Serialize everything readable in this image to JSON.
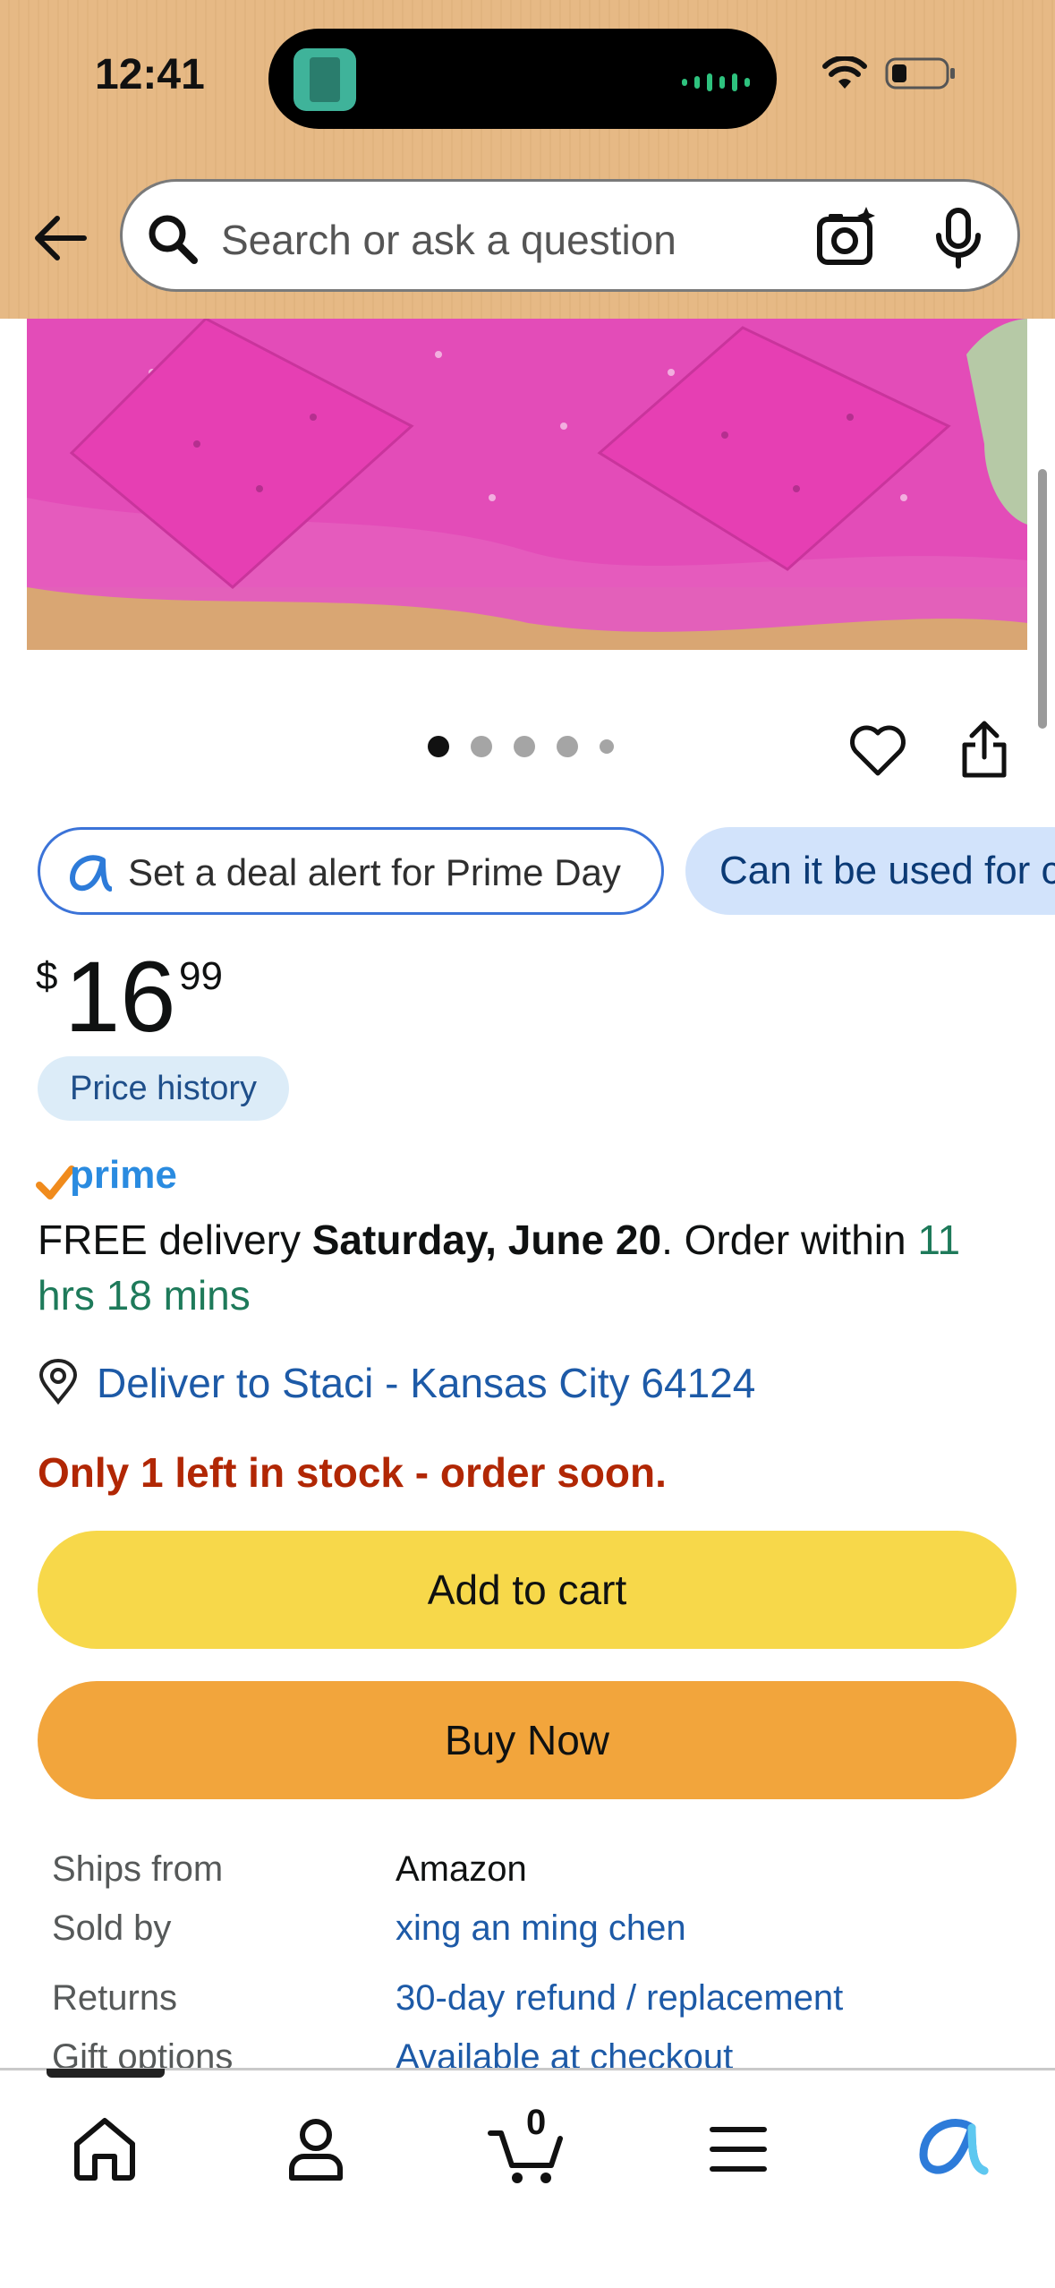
{
  "status_bar": {
    "time": "12:41"
  },
  "search": {
    "placeholder": "Search or ask a question"
  },
  "gallery": {
    "image_count": 5,
    "active_index": 0
  },
  "chips": {
    "deal_alert": "Set a deal alert for Prime Day",
    "question": "Can it be used for c"
  },
  "price": {
    "symbol": "$",
    "whole": "16",
    "fraction": "99",
    "history_label": "Price history"
  },
  "delivery": {
    "prime_label": "prime",
    "free_text": "FREE delivery ",
    "date": "Saturday, June 20",
    "order_within": ". Order within ",
    "countdown": "11 hrs 18 mins",
    "deliver_to": "Deliver to Staci - Kansas City 64124"
  },
  "stock": {
    "warning": "Only 1 left in stock - order soon."
  },
  "actions": {
    "add_to_cart": "Add to cart",
    "buy_now": "Buy Now"
  },
  "details": [
    {
      "key": "Ships from",
      "value": "Amazon"
    },
    {
      "key": "Sold by",
      "value": "xing an ming chen"
    },
    {
      "key": "Returns",
      "value": "30-day refund / replacement"
    },
    {
      "key": "Gift options",
      "value": "Available at checkout"
    }
  ],
  "bottom_nav": {
    "cart_count": "0",
    "items": [
      "home-icon",
      "account-icon",
      "cart-icon",
      "menu-icon",
      "rufus-icon"
    ]
  },
  "colors": {
    "header_bg": "#e6b985",
    "add_to_cart": "#f7d84a",
    "buy_now": "#f2a53c",
    "link_blue": "#1d5aa7",
    "stock_red": "#b12704",
    "delivery_green": "#1e7a5a"
  }
}
